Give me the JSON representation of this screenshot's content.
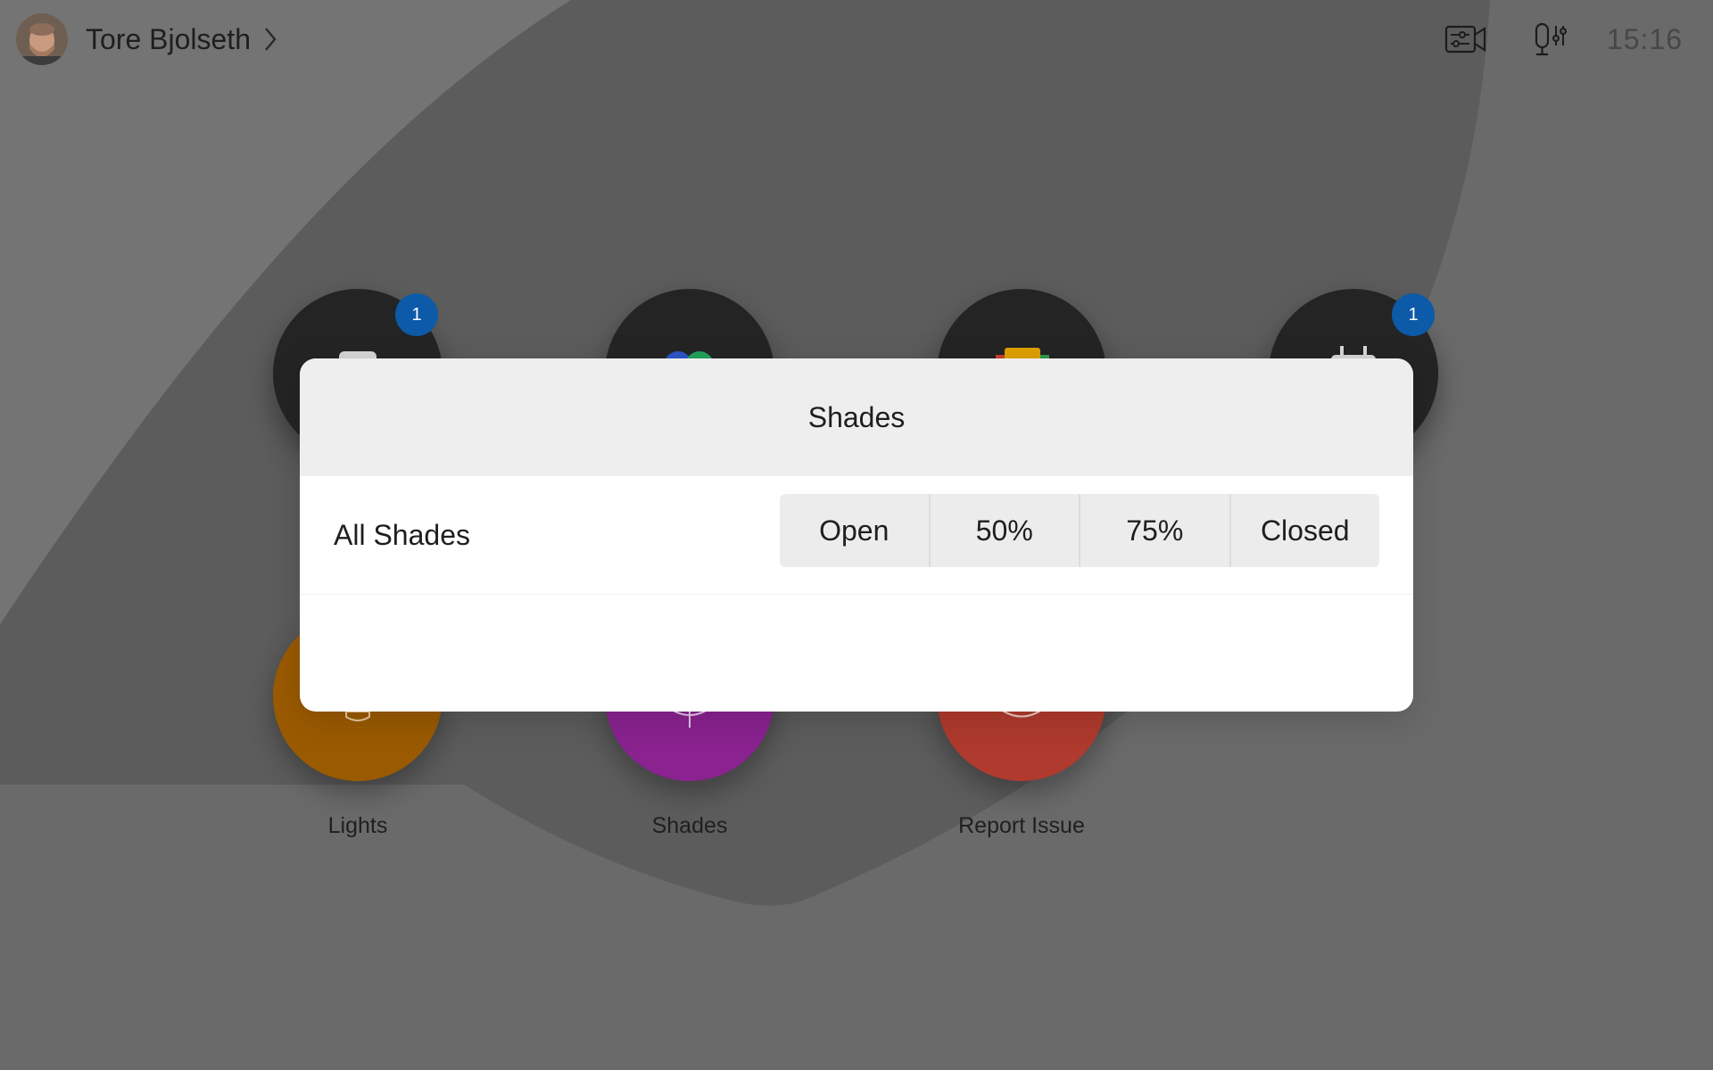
{
  "header": {
    "user_name": "Tore Bjolseth",
    "time": "15:16",
    "icons": [
      "camera-settings-icon",
      "microphone-settings-icon"
    ]
  },
  "tiles": [
    {
      "name": "tile-1",
      "badge": "1",
      "label": ""
    },
    {
      "name": "tile-2",
      "badge": "",
      "label": ""
    },
    {
      "name": "tile-3",
      "badge": "",
      "label": ""
    },
    {
      "name": "tile-4",
      "badge": "1",
      "label": ""
    },
    {
      "name": "tile-lights",
      "badge": "",
      "label": "Lights",
      "color": "#9a5a00"
    },
    {
      "name": "tile-shades",
      "badge": "",
      "label": "Shades",
      "color": "#8a2290"
    },
    {
      "name": "tile-report-issue",
      "badge": "",
      "label": "Report Issue",
      "color": "#b03a2e"
    }
  ],
  "modal": {
    "title": "Shades",
    "rows": [
      {
        "label": "All Shades",
        "options": [
          "Open",
          "50%",
          "75%",
          "Closed"
        ]
      }
    ]
  },
  "colors": {
    "badge": "#0d5aa8",
    "background": "#6e6e6e",
    "tile_dark": "#242424"
  }
}
